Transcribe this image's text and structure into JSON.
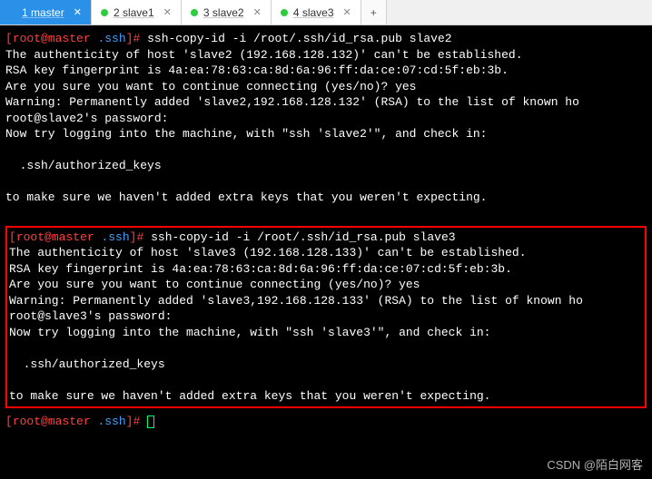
{
  "tabs": {
    "t1": {
      "num": "1",
      "name": "master"
    },
    "t2": {
      "num": "2",
      "name": "slave1"
    },
    "t3": {
      "num": "3",
      "name": "slave2"
    },
    "t4": {
      "num": "4",
      "name": "slave3"
    },
    "add": "+"
  },
  "block1": {
    "prompt_user": "root@master",
    "prompt_path": ".ssh",
    "cmd": "ssh-copy-id -i /root/.ssh/id_rsa.pub slave2",
    "l1": "The authenticity of host 'slave2 (192.168.128.132)' can't be established.",
    "l2": "RSA key fingerprint is 4a:ea:78:63:ca:8d:6a:96:ff:da:ce:07:cd:5f:eb:3b.",
    "l3": "Are you sure you want to continue connecting (yes/no)? yes",
    "l4": "Warning: Permanently added 'slave2,192.168.128.132' (RSA) to the list of known ho",
    "l5": "root@slave2's password:",
    "l6": "Now try logging into the machine, with \"ssh 'slave2'\", and check in:",
    "l7": "  .ssh/authorized_keys",
    "l8": "to make sure we haven't added extra keys that you weren't expecting."
  },
  "block2": {
    "prompt_user": "root@master",
    "prompt_path": ".ssh",
    "cmd": "ssh-copy-id -i /root/.ssh/id_rsa.pub slave3",
    "l1": "The authenticity of host 'slave3 (192.168.128.133)' can't be established.",
    "l2": "RSA key fingerprint is 4a:ea:78:63:ca:8d:6a:96:ff:da:ce:07:cd:5f:eb:3b.",
    "l3": "Are you sure you want to continue connecting (yes/no)? yes",
    "l4": "Warning: Permanently added 'slave3,192.168.128.133' (RSA) to the list of known ho",
    "l5": "root@slave3's password:",
    "l6": "Now try logging into the machine, with \"ssh 'slave3'\", and check in:",
    "l7": "  .ssh/authorized_keys",
    "l8": "to make sure we haven't added extra keys that you weren't expecting."
  },
  "final": {
    "prompt_user": "root@master",
    "prompt_path": ".ssh"
  },
  "watermark": "CSDN @陌白网客"
}
